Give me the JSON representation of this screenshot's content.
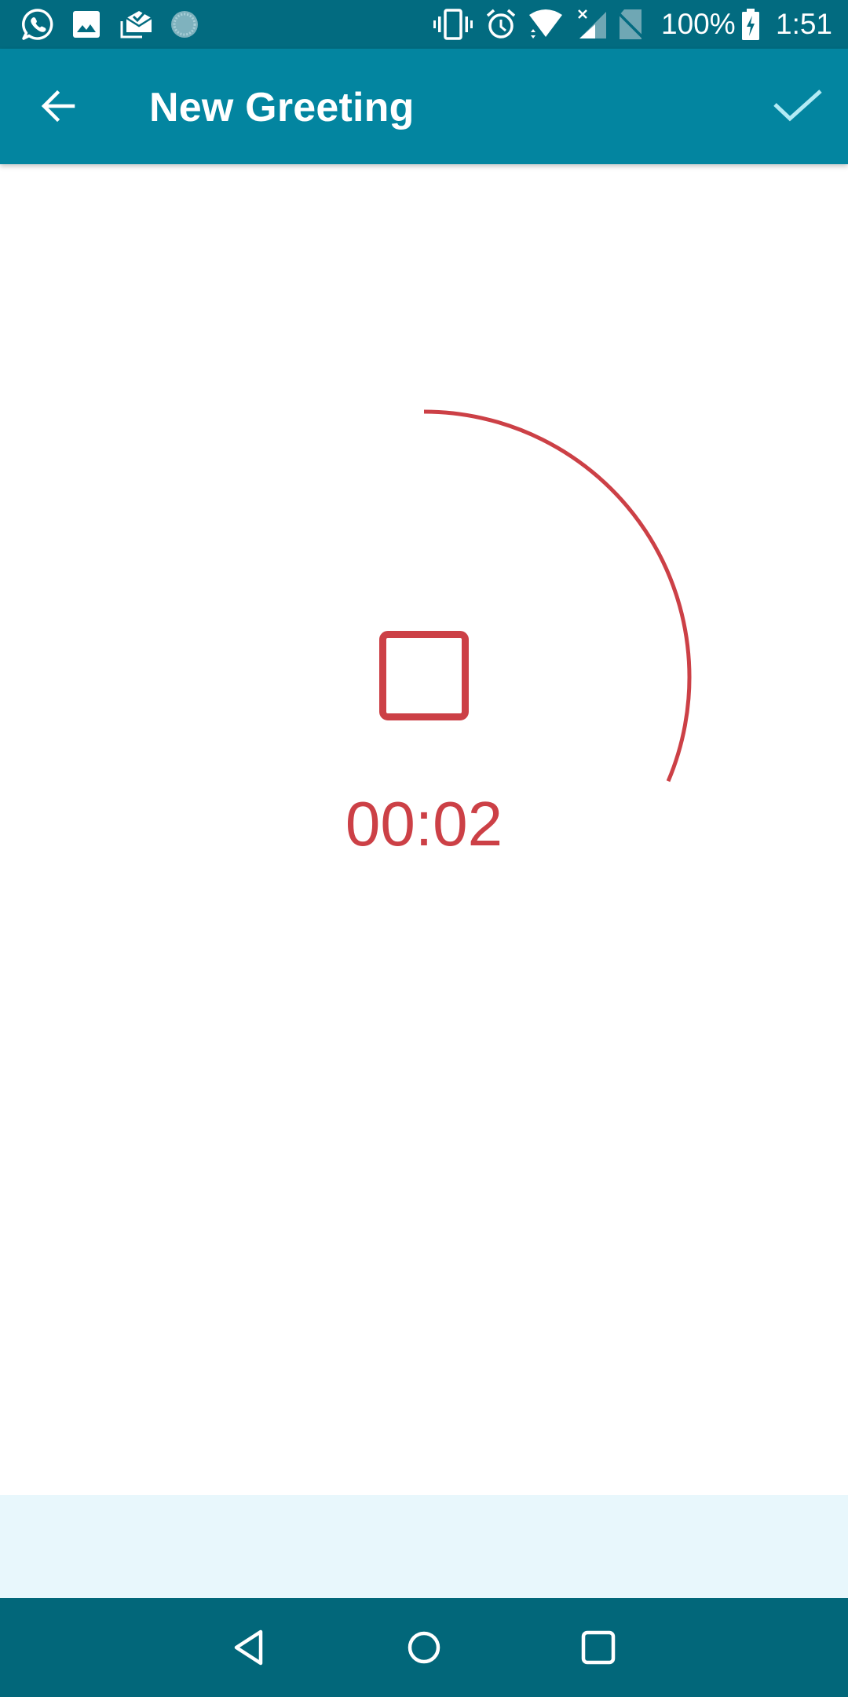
{
  "status_bar": {
    "notification_icons": [
      "whatsapp-icon",
      "gallery-icon",
      "mail-check-icon",
      "sync-icon"
    ],
    "system_icons": [
      "vibrate-icon",
      "alarm-icon",
      "wifi-icon",
      "cell-signal-no-data-icon",
      "no-sim-icon"
    ],
    "battery_percent": "100%",
    "battery_state": "charging",
    "time": "1:51"
  },
  "app_bar": {
    "title": "New Greeting",
    "back_icon": "arrow-back-icon",
    "confirm_icon": "check-icon"
  },
  "recorder": {
    "state": "recording",
    "elapsed": "00:02",
    "progress_fraction": 0.314,
    "stop_icon": "stop-icon"
  },
  "colors": {
    "status_bar": "#026B80",
    "app_bar": "#0385A0",
    "accent_red": "#CC4046",
    "bottom_band": "#E8F7FC",
    "nav_bar": "#02677A",
    "confirm_tint": "#B3EBF5"
  },
  "nav_bar": {
    "buttons": [
      "back",
      "home",
      "recents"
    ]
  }
}
